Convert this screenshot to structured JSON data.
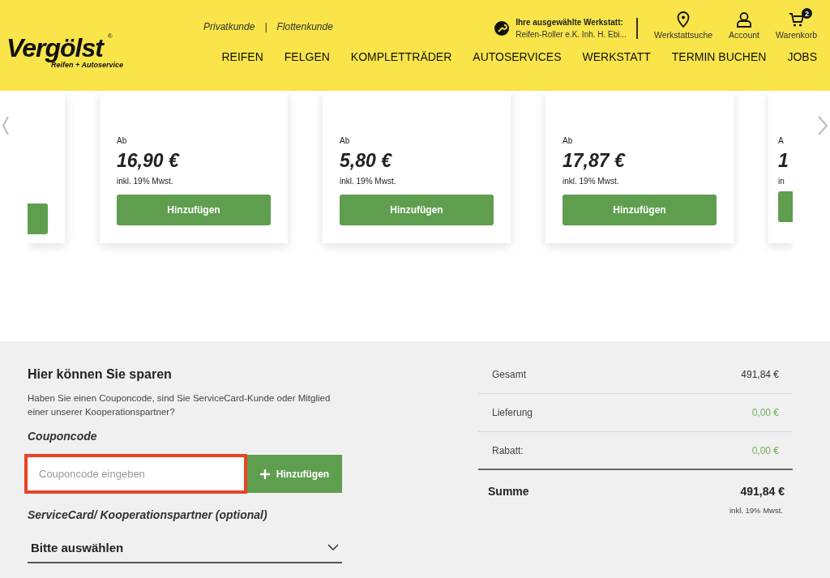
{
  "header": {
    "logo": {
      "name": "Vergölst",
      "mark": "®",
      "tagline": "Reifen + Autoservice"
    },
    "customer_links": [
      {
        "label": "Privatkunde"
      },
      {
        "label": "Flottenkunde"
      }
    ],
    "link_separator": "|",
    "workshop": {
      "label": "Ihre ausgewählte Werkstatt:",
      "name": "Reifen-Roller e.K. Inh. H. Ebi..."
    },
    "icons": [
      {
        "kind": "pin",
        "label": "Werkstattsuche"
      },
      {
        "kind": "account",
        "label": "Account"
      },
      {
        "kind": "cart",
        "label": "Warenkorb",
        "badge": "2"
      }
    ],
    "nav": [
      "REIFEN",
      "FELGEN",
      "KOMPLETTRÄDER",
      "AUTOSERVICES",
      "WERKSTATT",
      "TERMIN BUCHEN",
      "JOBS"
    ]
  },
  "carousel": {
    "cards": [
      {
        "kind": "partial-left"
      },
      {
        "kind": "full",
        "prefix": "Ab",
        "price": "16,90 €",
        "tax": "inkl. 19% Mwst.",
        "button": "Hinzufügen"
      },
      {
        "kind": "full",
        "prefix": "Ab",
        "price": "5,80 €",
        "tax": "inkl. 19% Mwst.",
        "button": "Hinzufügen"
      },
      {
        "kind": "full",
        "prefix": "Ab",
        "price": "17,87 €",
        "tax": "inkl. 19% Mwst.",
        "button": "Hinzufügen"
      },
      {
        "kind": "partial-right",
        "prefix": "A",
        "price": "1",
        "tax": "in"
      }
    ]
  },
  "savings": {
    "title": "Hier können Sie sparen",
    "text": "Haben Sie einen Couponcode, sind Sie ServiceCard-Kunde oder Mitglied einer unserer Kooperationspartner?",
    "coupon_label": "Couponcode",
    "coupon": {
      "placeholder": "Couponcode eingeben",
      "highlighted": true
    },
    "add_button": "Hinzufügen",
    "service_label": "ServiceCard/ Kooperationspartner (optional)",
    "select_value": "Bitte auswählen"
  },
  "summary": {
    "rows": [
      {
        "label": "Gesamt",
        "value": "491,84 €",
        "kind": "plain"
      },
      {
        "label": "Lieferung",
        "value": "0,00 €",
        "kind": "green"
      },
      {
        "label": "Rabatt:",
        "value": "0,00 €",
        "kind": "green"
      }
    ],
    "total": {
      "label": "Summe",
      "value": "491,84 €",
      "note": "inkl. 19% Mwst."
    }
  }
}
